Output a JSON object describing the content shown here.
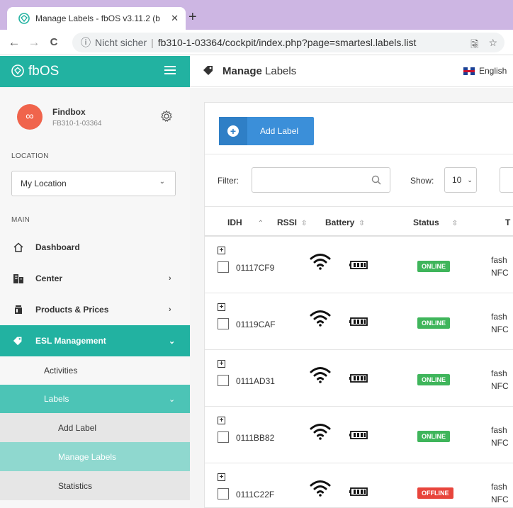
{
  "browser": {
    "tab_title": "Manage Labels - fbOS v3.11.2 (b",
    "tab_close": "✕",
    "new_tab": "+",
    "back": "←",
    "forward": "→",
    "reload": "C",
    "info": "ⓘ",
    "insecure_label": "Nicht sicher",
    "separator": "|",
    "url": "fb310-1-03364/cockpit/index.php?page=smartesl.labels.list",
    "translate": "🗟",
    "star": "☆"
  },
  "sidebar": {
    "brand": "fbOS",
    "profile": {
      "name": "Findbox",
      "id": "FB310-1-03364",
      "avatar_glyph": "∞"
    },
    "location_label": "LOCATION",
    "location_value": "My Location",
    "main_label": "MAIN",
    "menu": [
      {
        "label": "Dashboard",
        "icon": "home-icon"
      },
      {
        "label": "Center",
        "icon": "building-icon",
        "chevron": "›"
      },
      {
        "label": "Products & Prices",
        "icon": "jar-icon",
        "chevron": "›"
      },
      {
        "label": "ESL Management",
        "icon": "tag-icon",
        "chevron": "⌄"
      }
    ],
    "submenu": [
      {
        "label": "Activities"
      },
      {
        "label": "Labels",
        "chevron": "⌄"
      }
    ],
    "labels_submenu": [
      {
        "label": "Add Label"
      },
      {
        "label": "Manage Labels"
      },
      {
        "label": "Statistics"
      }
    ]
  },
  "topbar": {
    "title_bold": "Manage",
    "title_rest": " Labels",
    "language": "English"
  },
  "toolbar": {
    "add_label": "Add Label",
    "filter_label": "Filter:",
    "filter_value": "",
    "show_label": "Show:",
    "show_value": "10"
  },
  "table": {
    "columns": [
      {
        "label": "IDH",
        "sort": "⌃"
      },
      {
        "label": "RSSI",
        "sort": "⇳"
      },
      {
        "label": "Battery",
        "sort": "⇳"
      },
      {
        "label": "Status",
        "sort": "⇳"
      },
      {
        "label": "T",
        "sort": ""
      }
    ],
    "rows": [
      {
        "idh": "01117CF9",
        "status": "ONLINE",
        "type_line1": "fash",
        "type_line2": "NFC"
      },
      {
        "idh": "01119CAF",
        "status": "ONLINE",
        "type_line1": "fash",
        "type_line2": "NFC"
      },
      {
        "idh": "0111AD31",
        "status": "ONLINE",
        "type_line1": "fash",
        "type_line2": "NFC"
      },
      {
        "idh": "0111BB82",
        "status": "ONLINE",
        "type_line1": "fash",
        "type_line2": "NFC"
      },
      {
        "idh": "0111C22F",
        "status": "OFFLINE",
        "type_line1": "fash",
        "type_line2": "NFC"
      }
    ]
  },
  "colors": {
    "accent": "#22b2a1",
    "accent_light": "#4cc4b6",
    "current_item": "#8fd8cf",
    "primary_button": "#3b8fd9",
    "online": "#3fb55b",
    "offline": "#e8453c",
    "tabbar": "#cdb6e3"
  }
}
